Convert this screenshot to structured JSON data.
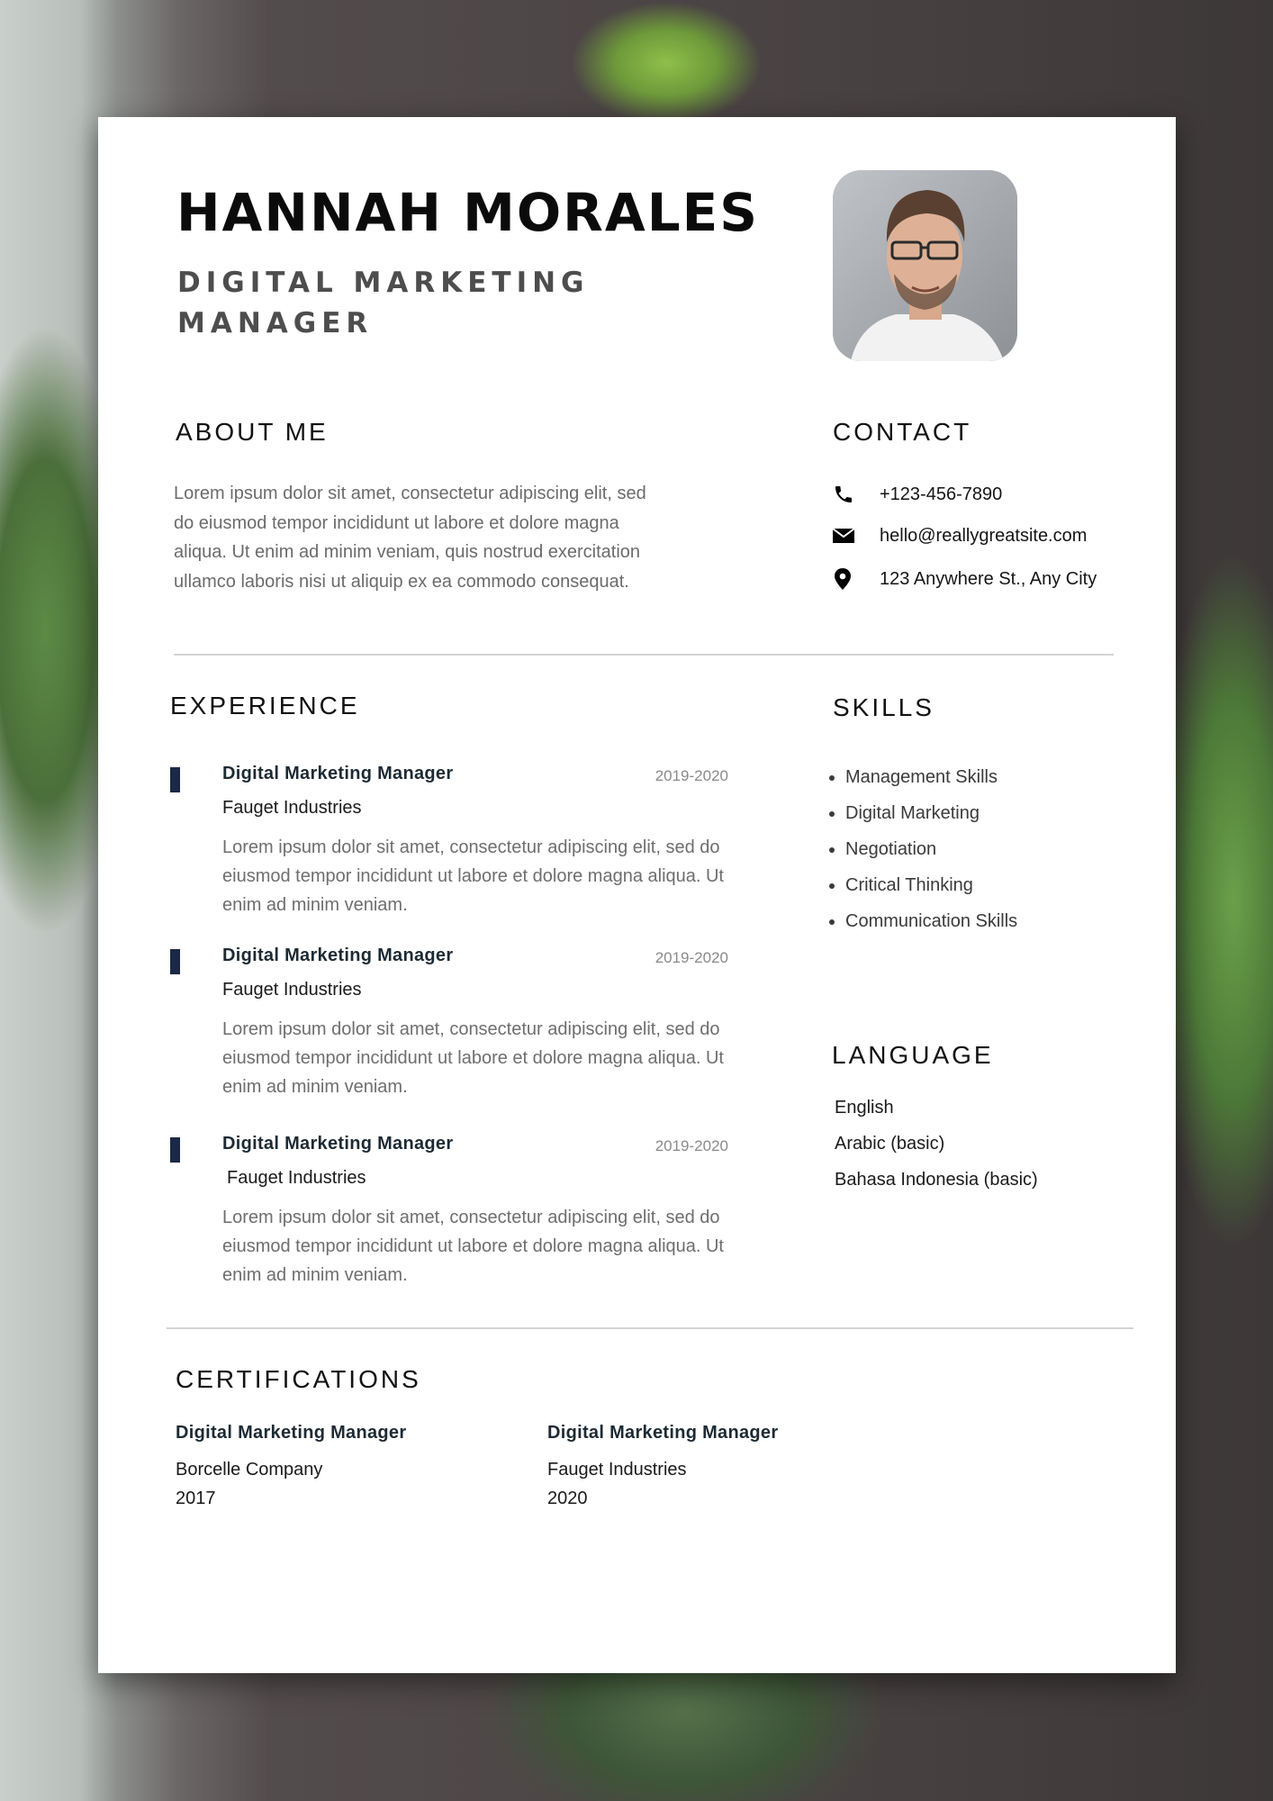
{
  "header": {
    "name": "HANNAH MORALES",
    "title": "DIGITAL MARKETING MANAGER",
    "photo_alt": "profile-photo"
  },
  "about": {
    "heading": "ABOUT ME",
    "text": "Lorem ipsum dolor sit amet, consectetur adipiscing elit, sed do eiusmod tempor incididunt ut labore et dolore magna aliqua. Ut enim ad minim veniam, quis nostrud exercitation ullamco laboris nisi ut aliquip ex ea commodo consequat."
  },
  "contact": {
    "heading": "CONTACT",
    "items": [
      {
        "icon": "phone-icon",
        "value": "+123-456-7890"
      },
      {
        "icon": "email-icon",
        "value": "hello@reallygreatsite.com"
      },
      {
        "icon": "location-pin-icon",
        "value": "123 Anywhere St., Any City"
      }
    ]
  },
  "experience": {
    "heading": "EXPERIENCE",
    "items": [
      {
        "role": "Digital Marketing Manager",
        "company": "Fauget Industries",
        "dates": "2019-2020",
        "description": "Lorem ipsum dolor sit amet, consectetur adipiscing elit, sed do eiusmod tempor incididunt ut labore et dolore magna aliqua. Ut enim ad minim veniam."
      },
      {
        "role": "Digital Marketing Manager",
        "company": "Fauget Industries",
        "dates": "2019-2020",
        "description": "Lorem ipsum dolor sit amet, consectetur adipiscing elit, sed do eiusmod tempor incididunt ut labore et dolore magna aliqua. Ut enim ad minim veniam."
      },
      {
        "role": "Digital Marketing Manager",
        "company": "Fauget Industries",
        "dates": "2019-2020",
        "description": "Lorem ipsum dolor sit amet, consectetur adipiscing elit, sed do eiusmod tempor incididunt ut labore et dolore magna aliqua. Ut enim ad minim veniam."
      }
    ]
  },
  "skills": {
    "heading": "SKILLS",
    "items": [
      "Management Skills",
      "Digital Marketing",
      "Negotiation",
      "Critical Thinking",
      "Communication Skills"
    ]
  },
  "language": {
    "heading": "LANGUAGE",
    "items": [
      "English",
      "Arabic (basic)",
      "Bahasa Indonesia (basic)"
    ]
  },
  "certifications": {
    "heading": "CERTIFICATIONS",
    "items": [
      {
        "role": "Digital Marketing Manager",
        "company": "Borcelle Company",
        "year": "2017"
      },
      {
        "role": "Digital Marketing Manager",
        "company": "Fauget Industries",
        "year": "2020"
      }
    ]
  },
  "colors": {
    "accent_bar": "#1b2847",
    "heading_text": "#111111",
    "body_text": "#6b6b6b",
    "divider": "#d3d3d3"
  }
}
